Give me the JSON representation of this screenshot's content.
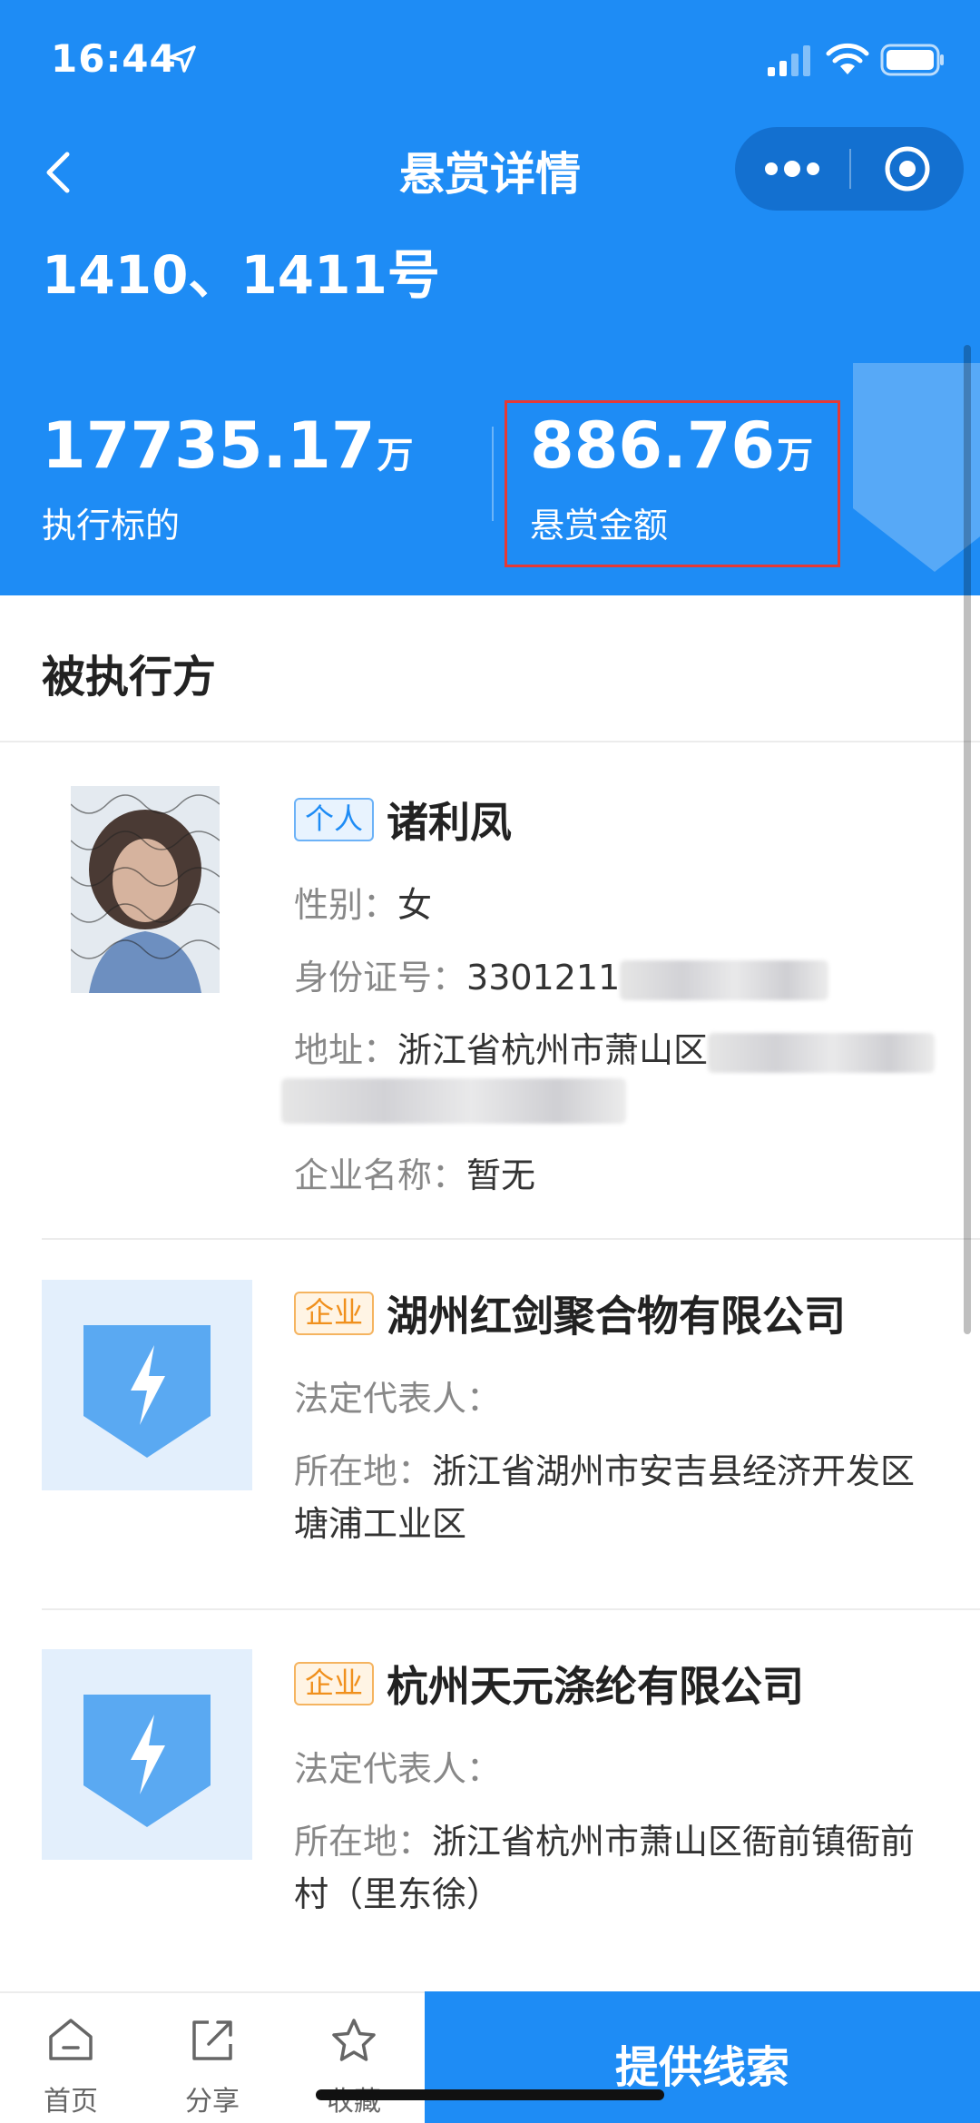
{
  "status_bar": {
    "time": "16:44"
  },
  "nav": {
    "title": "悬赏详情"
  },
  "case": {
    "number": "1410、1411号"
  },
  "stats": {
    "target_value": "17735.17",
    "target_unit": "万",
    "target_label": "执行标的",
    "reward_value": "886.76",
    "reward_unit": "万",
    "reward_label": "悬赏金额"
  },
  "section": {
    "title": "被执行方"
  },
  "entries": [
    {
      "tag": "个人",
      "name": "诸利凤",
      "gender_label": "性别：",
      "gender": "女",
      "id_label": "身份证号：",
      "id_value": "3301211",
      "address_label": "地址：",
      "address": "浙江省杭州市萧山区",
      "company_label": "企业名称：",
      "company": "暂无"
    },
    {
      "tag": "企业",
      "name": "湖州红剑聚合物有限公司",
      "rep_label": "法定代表人：",
      "rep": "",
      "location_label": "所在地：",
      "location_line1": "浙江省湖州市安吉县经济开发区",
      "location_line2": "塘浦工业区"
    },
    {
      "tag": "企业",
      "name": "杭州天元涤纶有限公司",
      "rep_label": "法定代表人：",
      "rep": "",
      "location_label": "所在地：",
      "location_line1": "浙江省杭州市萧山区衙前镇衙前",
      "location_line2": "村（里东徐）"
    }
  ],
  "bottom_bar": {
    "home": "首页",
    "share": "分享",
    "favorite": "收藏",
    "provide_clue": "提供线索"
  },
  "colors": {
    "primary": "#1e8cf5",
    "highlight_border": "#e53935",
    "tag_person": "#1e8cf5",
    "tag_company": "#f0901d"
  }
}
